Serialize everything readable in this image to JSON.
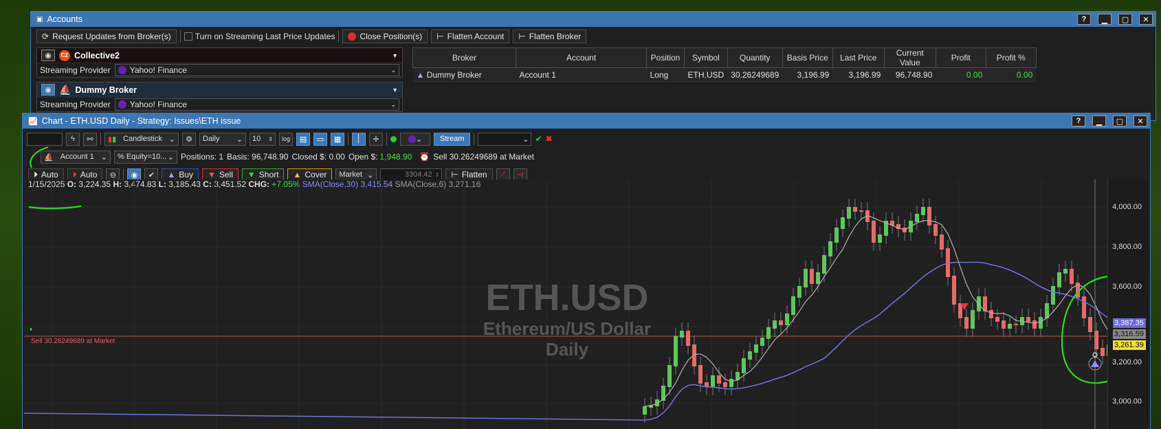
{
  "accounts_window": {
    "title": "Accounts",
    "toolbar": {
      "request_updates": "Request Updates from Broker(s)",
      "streaming_toggle": "Turn on Streaming Last Price Updates",
      "close_positions": "Close Position(s)",
      "flatten_account": "Flatten Account",
      "flatten_broker": "Flatten Broker"
    },
    "providers": [
      {
        "name": "Collective2",
        "label": "Streaming Provider",
        "value": "Yahoo! Finance"
      },
      {
        "name": "Dummy Broker",
        "label": "Streaming Provider",
        "value": "Yahoo! Finance"
      }
    ],
    "table": {
      "headers": [
        "Broker",
        "Account",
        "Position",
        "Symbol",
        "Quantity",
        "Basis Price",
        "Last Price",
        "Current Value",
        "Profit",
        "Profit %"
      ],
      "rows": [
        {
          "broker": "Dummy Broker",
          "account": "Account 1",
          "position": "Long",
          "symbol": "ETH.USD",
          "quantity": "30.26249689",
          "basis": "3,196.99",
          "last": "3,196.99",
          "value": "96,748.90",
          "profit": "0.00",
          "profit_pct": "0.00"
        }
      ]
    }
  },
  "chart_window": {
    "title": "Chart - ETH.USD Daily - Strategy: Issues\\ETH issue",
    "toolbar": {
      "chart_type": "Candlestick",
      "interval": "Daily",
      "bars": "10",
      "log": "log",
      "stream": "Stream",
      "account": "Account 1",
      "sizing": "% Equity=10...",
      "positions": "Positions: 1",
      "basis": "Basis: 96,748.90",
      "closed": "Closed $: 0.00",
      "open_label": "Open $:",
      "open_value": "1,948.90",
      "pending": "Sell 30.26249689 at Market",
      "auto1": "Auto",
      "auto2": "Auto",
      "buy": "Buy",
      "sell": "Sell",
      "short": "Short",
      "cover": "Cover",
      "order_type": "Market",
      "price": "3304.42",
      "flatten": "Flatten"
    },
    "ohlc": {
      "date": "1/15/2025",
      "o_label": "O:",
      "o": "3,224.35",
      "h_label": "H:",
      "h": "3,474.83",
      "l_label": "L:",
      "l": "3,185.43",
      "c_label": "C:",
      "c": "3,451.52",
      "chg_label": "CHG:",
      "chg": "+7.05%",
      "sma30": "SMA(Close,30) 3,415.54",
      "sma6": "SMA(Close,6) 3,271.16"
    },
    "watermark": {
      "symbol": "ETH.USD",
      "name": "Ethereum/US Dollar",
      "interval": "Daily"
    },
    "order_line_label": "Sell 30.26249689 at Market",
    "price_axis": [
      "4,000.00",
      "3,800.00",
      "3,600.00",
      "3,200.00",
      "3,000.00"
    ],
    "price_tags": {
      "sma30": "3,387.35",
      "sma6": "3,316.59",
      "last": "3,261.39"
    }
  }
}
